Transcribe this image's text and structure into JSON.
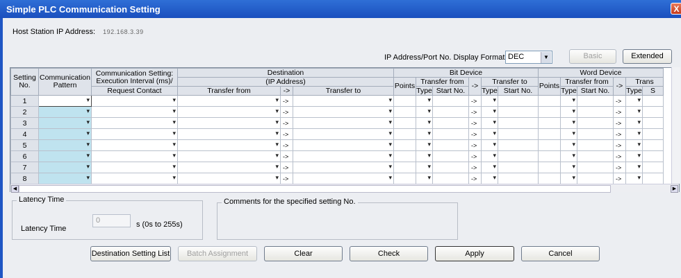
{
  "window": {
    "title": "Simple PLC Communication Setting",
    "close_glyph": "X"
  },
  "host": {
    "label": "Host Station IP Address:",
    "value": "192.168.3.39"
  },
  "display_format": {
    "label": "IP Address/Port No. Display Format",
    "value": "DEC"
  },
  "buttons": {
    "basic": "Basic",
    "extended": "Extended",
    "destination_list": "Destination Setting List",
    "batch_assignment": "Batch Assignment",
    "clear": "Clear",
    "check": "Check",
    "apply": "Apply",
    "cancel": "Cancel"
  },
  "table": {
    "h_setting": "Setting",
    "h_no": "No.",
    "h_comm": "Communication",
    "h_pattern": "Pattern",
    "h_cs1": "Communication Setting:",
    "h_cs2": "Execution Interval (ms)/",
    "h_cs3": "Request Contact",
    "h_dest": "Destination",
    "h_ip": "(IP Address)",
    "h_transfer_from": "Transfer from",
    "h_arrow": "->",
    "h_transfer_to": "Transfer to",
    "h_bit": "Bit Device",
    "h_word": "Word Device",
    "h_points": "Points",
    "h_type": "Type",
    "h_start": "Start No.",
    "h_trans_partial": "Trans",
    "h_s_partial": "S",
    "rows": [
      "1",
      "2",
      "3",
      "4",
      "5",
      "6",
      "7",
      "8"
    ]
  },
  "latency": {
    "group": "Latency Time",
    "label": "Latency Time",
    "value": "0",
    "unit": "s  (0s to 255s)"
  },
  "comments": {
    "group": "Comments for the specified setting No."
  }
}
